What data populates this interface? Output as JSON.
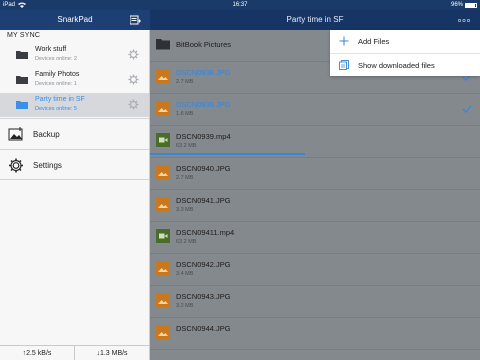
{
  "statusbar": {
    "device": "iPad",
    "time": "16:37",
    "battery": "96%"
  },
  "sidebar": {
    "app_title": "SnarkPad",
    "section_label": "MY SYNC",
    "folders": [
      {
        "name": "Work stuff",
        "sub": "Devices online: 2",
        "selected": false
      },
      {
        "name": "Family Photos",
        "sub": "Devices online: 1",
        "selected": false
      },
      {
        "name": "Party time in SF",
        "sub": "Devices online: 5",
        "selected": true
      }
    ],
    "menu": [
      {
        "label": "Backup",
        "icon": "backup-photo-icon"
      },
      {
        "label": "Settings",
        "icon": "gear-icon"
      }
    ],
    "footer": {
      "upload": "↑2.5 kB/s",
      "download": "↓1.3 MB/s"
    }
  },
  "main": {
    "title": "Party time in SF",
    "files": [
      {
        "name": "BitBook Pictures",
        "size": "",
        "type": "folder",
        "synced": false,
        "downloading": false
      },
      {
        "name": "DSCN0938.JPG",
        "size": "2.7 MB",
        "type": "image",
        "synced": true,
        "downloading": false
      },
      {
        "name": "DSCN0939.JPG",
        "size": "1.6 MB",
        "type": "image",
        "synced": true,
        "downloading": false
      },
      {
        "name": "DSCN0939.mp4",
        "size": "63.2 MB",
        "type": "video",
        "synced": false,
        "downloading": true,
        "progress": 0.47
      },
      {
        "name": "DSCN0940.JPG",
        "size": "2.7 MB",
        "type": "image",
        "synced": false,
        "downloading": false
      },
      {
        "name": "DSCN0941.JPG",
        "size": "3.3 MB",
        "type": "image",
        "synced": false,
        "downloading": false
      },
      {
        "name": "DSCN09411.mp4",
        "size": "63.2 MB",
        "type": "video",
        "synced": false,
        "downloading": false
      },
      {
        "name": "DSCN0942.JPG",
        "size": "3.4 MB",
        "type": "image",
        "synced": false,
        "downloading": false
      },
      {
        "name": "DSCN0943.JPG",
        "size": "3.2 MB",
        "type": "image",
        "synced": false,
        "downloading": false
      },
      {
        "name": "DSCN0944.JPG",
        "size": "",
        "type": "image",
        "synced": false,
        "downloading": false
      }
    ]
  },
  "dropdown": {
    "items": [
      {
        "label": "Add Files",
        "icon": "plus-icon"
      },
      {
        "label": "Show downloaded files",
        "icon": "downloaded-files-icon"
      }
    ]
  },
  "colors": {
    "accent": "#3a86d4",
    "header": "#1e3f73",
    "image_thumb": "#c9781e",
    "video_thumb": "#4a6c2c"
  }
}
